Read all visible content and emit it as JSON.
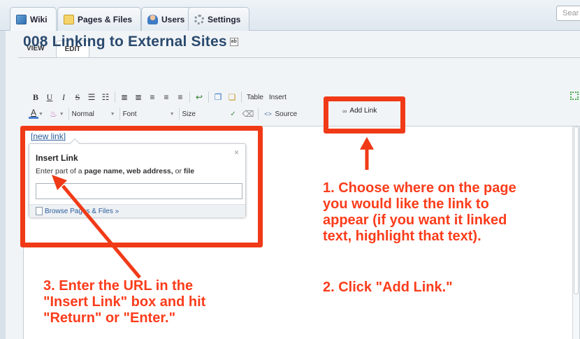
{
  "top_tabs": [
    {
      "label": "Wiki",
      "icon": "wiki-icon"
    },
    {
      "label": "Pages & Files",
      "icon": "folder-icon"
    },
    {
      "label": "Users",
      "icon": "users-icon"
    },
    {
      "label": "Settings",
      "icon": "gear-icon"
    }
  ],
  "search": {
    "placeholder": "Sear"
  },
  "sub_tabs": [
    {
      "label": "VIEW"
    },
    {
      "label": "EDIT"
    }
  ],
  "page_title": "008 Linking to External Sites",
  "toolbar": {
    "row1": {
      "bold": "B",
      "underline": "U",
      "italic": "I",
      "strike": "S",
      "table_label": "Table",
      "insert_label": "Insert"
    },
    "row2": {
      "style_value": "Normal",
      "font_value": "Font",
      "size_value": "Size",
      "source_label": "Source",
      "add_link_label": "Add Link"
    }
  },
  "editor": {
    "new_link_text": "[new link]"
  },
  "insert_link_popup": {
    "title": "Insert Link",
    "desc_prefix": "Enter part of a ",
    "desc_bold": "page name, web address,",
    "desc_mid": " or ",
    "desc_bold2": "file",
    "input_value": "",
    "browse_text": "Browse Pages & Files »",
    "close": "×"
  },
  "annotations": {
    "step1": "1. Choose where on the page\nyou would like the link to\nappear (if you want it linked\ntext, highlight that text).",
    "step2": "2. Click \"Add Link.\"",
    "step3": "3. Enter the URL in the\n\"Insert Link\" box and hit\n\"Return\" or \"Enter.\"",
    "color": "#f03a17"
  }
}
